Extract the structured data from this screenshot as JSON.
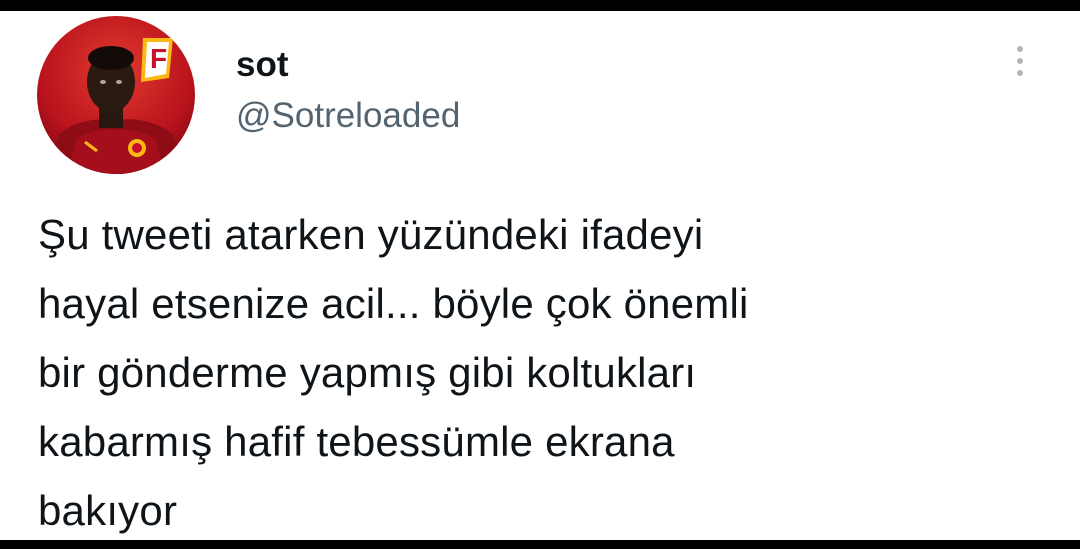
{
  "tweet": {
    "author": {
      "display_name": "sot",
      "handle": "@Sotreloaded",
      "avatar_icon": "profile-photo-footballer-with-f-logo"
    },
    "menu_icon": "more-vertical-icon",
    "text_lines": [
      "Şu tweeti atarken yüzündeki ifadeyi",
      "hayal etsenize acil... böyle çok önemli",
      "bir gönderme yapmış gibi koltukları",
      "kabarmış hafif tebessümle ekrana",
      "bakıyor"
    ]
  },
  "colors": {
    "frame": "#000000",
    "background": "#ffffff",
    "text_primary": "#0f1419",
    "text_secondary": "#536471",
    "avatar_red": "#c8102e",
    "avatar_yellow": "#fdb913"
  }
}
